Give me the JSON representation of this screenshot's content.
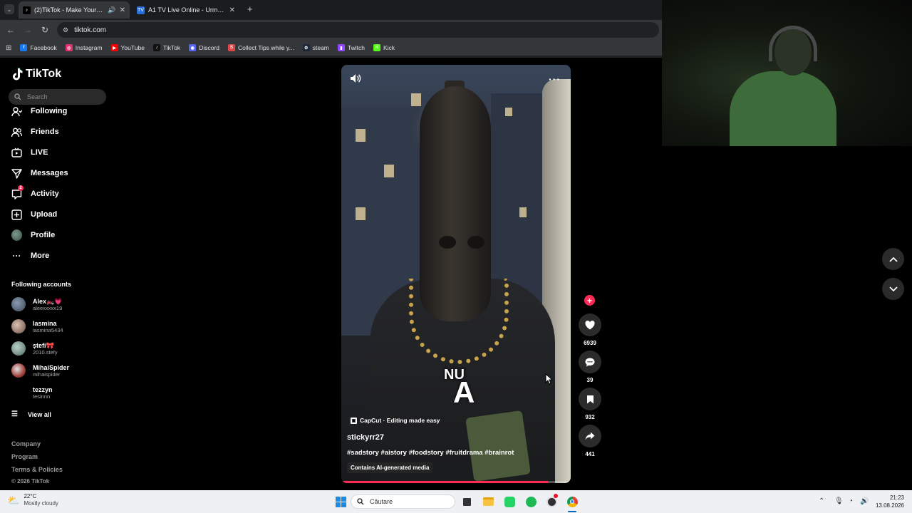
{
  "browser": {
    "tabs": [
      {
        "title": "(2)TikTok - Make Your Day",
        "active": true
      },
      {
        "title": "A1 TV Live Online - Urmareste",
        "active": false
      }
    ],
    "url": "tiktok.com",
    "bookmarks": [
      {
        "label": "Facebook",
        "color": "#1877f2",
        "glyph": "f"
      },
      {
        "label": "Instagram",
        "color": "#e1306c",
        "glyph": "◎"
      },
      {
        "label": "YouTube",
        "color": "#ff0000",
        "glyph": "▶"
      },
      {
        "label": "TikTok",
        "color": "#111111",
        "glyph": "♪"
      },
      {
        "label": "Discord",
        "color": "#5865f2",
        "glyph": "◉"
      },
      {
        "label": "Collect Tips while y...",
        "color": "#e04848",
        "glyph": "S"
      },
      {
        "label": "steam",
        "color": "#1b2838",
        "glyph": "⚙"
      },
      {
        "label": "Twitch",
        "color": "#9146ff",
        "glyph": "▮"
      },
      {
        "label": "Kick",
        "color": "#53fc18",
        "glyph": "K"
      }
    ]
  },
  "sidebar": {
    "logo": "TikTok",
    "search_placeholder": "Search",
    "nav": [
      {
        "label": "Following",
        "icon": "following-icon"
      },
      {
        "label": "Friends",
        "icon": "friends-icon"
      },
      {
        "label": "LIVE",
        "icon": "live-icon"
      },
      {
        "label": "Messages",
        "icon": "messages-icon"
      },
      {
        "label": "Activity",
        "icon": "activity-icon",
        "badge": "2"
      },
      {
        "label": "Upload",
        "icon": "upload-icon"
      },
      {
        "label": "Profile",
        "icon": "profile-icon"
      },
      {
        "label": "More",
        "icon": "more-icon"
      }
    ],
    "following_title": "Following accounts",
    "accounts": [
      {
        "name": "Alex🏍️💗",
        "handle": "aleexxxxx19",
        "color": "#6a7a90"
      },
      {
        "name": "Iasmina",
        "handle": "iasmina5434",
        "color": "#b79a8a"
      },
      {
        "name": "ștefi🎀",
        "handle": "2010.stefy",
        "color": "#8fb0a8"
      },
      {
        "name": "MihaiSpider",
        "handle": "mihaispider",
        "color": "#a0403a"
      },
      {
        "name": "tezzyn",
        "handle": "tesinnn",
        "color": "#000000"
      }
    ],
    "view_all": "View all",
    "footer": [
      "Company",
      "Program",
      "Terms & Policies"
    ],
    "copyright": "© 2026 TikTok"
  },
  "video": {
    "overlay_text_1": "NU",
    "overlay_text_2": "A",
    "capcut_label": "CapCut · Editing made easy",
    "author": "stickyrr27",
    "hashtags": "#sadstory #aistory #foodstory #fruitdrama #brainrot",
    "ai_label": "Contains AI-generated media",
    "progress": 0.9
  },
  "actions": {
    "likes": "6939",
    "comments": "39",
    "saves": "932",
    "shares": "441"
  },
  "taskbar": {
    "temperature": "22°C",
    "weather": "Mostly cloudy",
    "search_placeholder": "Căutare",
    "time": "21:23",
    "date": "13.08.2026"
  }
}
